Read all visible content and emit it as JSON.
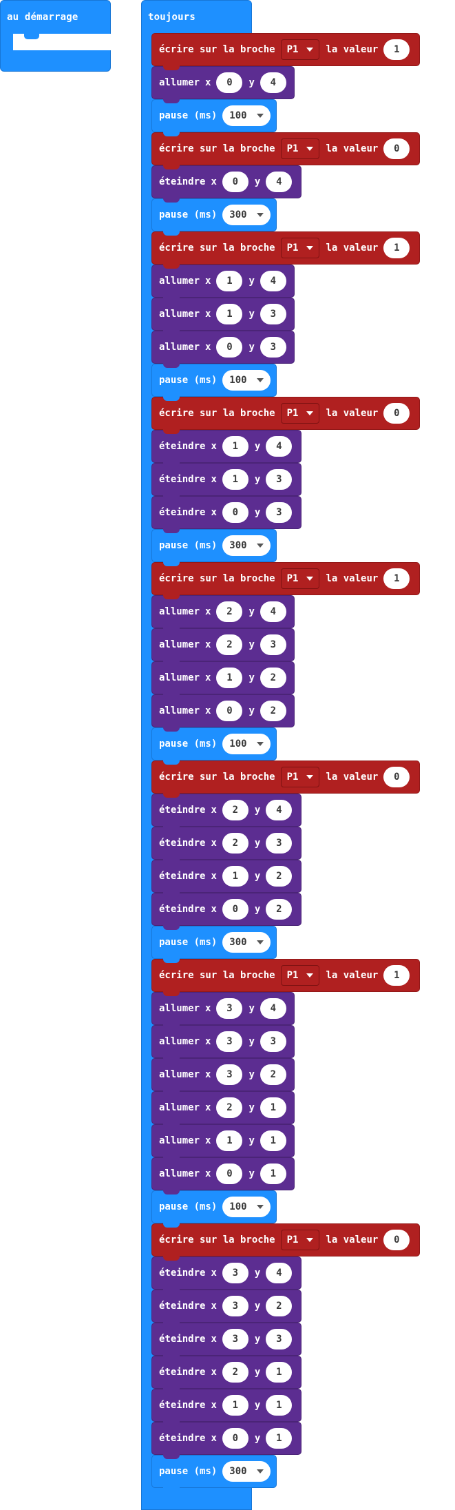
{
  "on_start": {
    "label": "au démarrage"
  },
  "forever": {
    "label": "toujours"
  },
  "colors": {
    "basic_blue": "#1e90ff",
    "pins_red": "#b02020",
    "led_purple": "#5c2d91",
    "field_white": "#ffffff"
  },
  "labels": {
    "write_prefix": "écrire sur la broche",
    "write_suffix": "la valeur",
    "plot": "allumer",
    "unplot": "éteindre",
    "pause": "pause (ms)",
    "x": "x",
    "y": "y"
  },
  "blocks": [
    {
      "type": "write",
      "pin": "P1",
      "value": "1"
    },
    {
      "type": "plot",
      "x": "0",
      "y": "4"
    },
    {
      "type": "pause",
      "ms": "100"
    },
    {
      "type": "write",
      "pin": "P1",
      "value": "0"
    },
    {
      "type": "unplot",
      "x": "0",
      "y": "4"
    },
    {
      "type": "pause",
      "ms": "300"
    },
    {
      "type": "write",
      "pin": "P1",
      "value": "1"
    },
    {
      "type": "plot",
      "x": "1",
      "y": "4"
    },
    {
      "type": "plot",
      "x": "1",
      "y": "3"
    },
    {
      "type": "plot",
      "x": "0",
      "y": "3"
    },
    {
      "type": "pause",
      "ms": "100"
    },
    {
      "type": "write",
      "pin": "P1",
      "value": "0"
    },
    {
      "type": "unplot",
      "x": "1",
      "y": "4"
    },
    {
      "type": "unplot",
      "x": "1",
      "y": "3"
    },
    {
      "type": "unplot",
      "x": "0",
      "y": "3"
    },
    {
      "type": "pause",
      "ms": "300"
    },
    {
      "type": "write",
      "pin": "P1",
      "value": "1"
    },
    {
      "type": "plot",
      "x": "2",
      "y": "4"
    },
    {
      "type": "plot",
      "x": "2",
      "y": "3"
    },
    {
      "type": "plot",
      "x": "1",
      "y": "2"
    },
    {
      "type": "plot",
      "x": "0",
      "y": "2"
    },
    {
      "type": "pause",
      "ms": "100"
    },
    {
      "type": "write",
      "pin": "P1",
      "value": "0"
    },
    {
      "type": "unplot",
      "x": "2",
      "y": "4"
    },
    {
      "type": "unplot",
      "x": "2",
      "y": "3"
    },
    {
      "type": "unplot",
      "x": "1",
      "y": "2"
    },
    {
      "type": "unplot",
      "x": "0",
      "y": "2"
    },
    {
      "type": "pause",
      "ms": "300"
    },
    {
      "type": "write",
      "pin": "P1",
      "value": "1"
    },
    {
      "type": "plot",
      "x": "3",
      "y": "4"
    },
    {
      "type": "plot",
      "x": "3",
      "y": "3"
    },
    {
      "type": "plot",
      "x": "3",
      "y": "2"
    },
    {
      "type": "plot",
      "x": "2",
      "y": "1"
    },
    {
      "type": "plot",
      "x": "1",
      "y": "1"
    },
    {
      "type": "plot",
      "x": "0",
      "y": "1"
    },
    {
      "type": "pause",
      "ms": "100"
    },
    {
      "type": "write",
      "pin": "P1",
      "value": "0"
    },
    {
      "type": "unplot",
      "x": "3",
      "y": "4"
    },
    {
      "type": "unplot",
      "x": "3",
      "y": "2"
    },
    {
      "type": "unplot",
      "x": "3",
      "y": "3"
    },
    {
      "type": "unplot",
      "x": "2",
      "y": "1"
    },
    {
      "type": "unplot",
      "x": "1",
      "y": "1"
    },
    {
      "type": "unplot",
      "x": "0",
      "y": "1"
    },
    {
      "type": "pause",
      "ms": "300"
    }
  ]
}
